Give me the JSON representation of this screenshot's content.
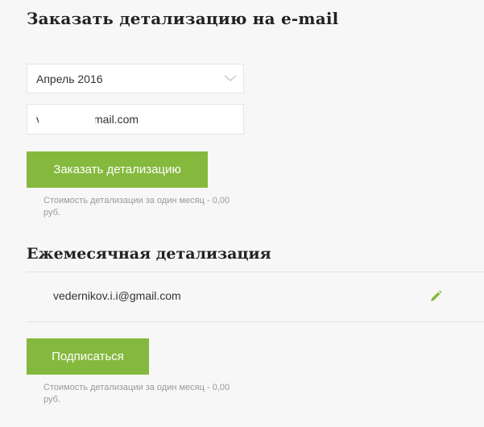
{
  "order_section": {
    "title": "Заказать детализацию на e-mail",
    "period_select": {
      "selected": "Апрель 2016",
      "icon": "chevron-down-icon"
    },
    "email_input": {
      "value": "v          i@gmail.com"
    },
    "order_button": "Заказать детализацию",
    "cost_note": "Стоимость детализации за один месяц - 0,00 руб."
  },
  "monthly_section": {
    "title": "Ежемесячная детализация",
    "subscription_email": "vedernikov.i.i@gmail.com",
    "edit_icon": "pencil-icon",
    "subscribe_button": "Подписаться",
    "cost_note": "Стоимость детализации за один месяц - 0,00 руб."
  },
  "colors": {
    "accent": "#85b93e",
    "background": "#f7f7f7",
    "text": "#333333",
    "muted": "#9a9a9a"
  }
}
